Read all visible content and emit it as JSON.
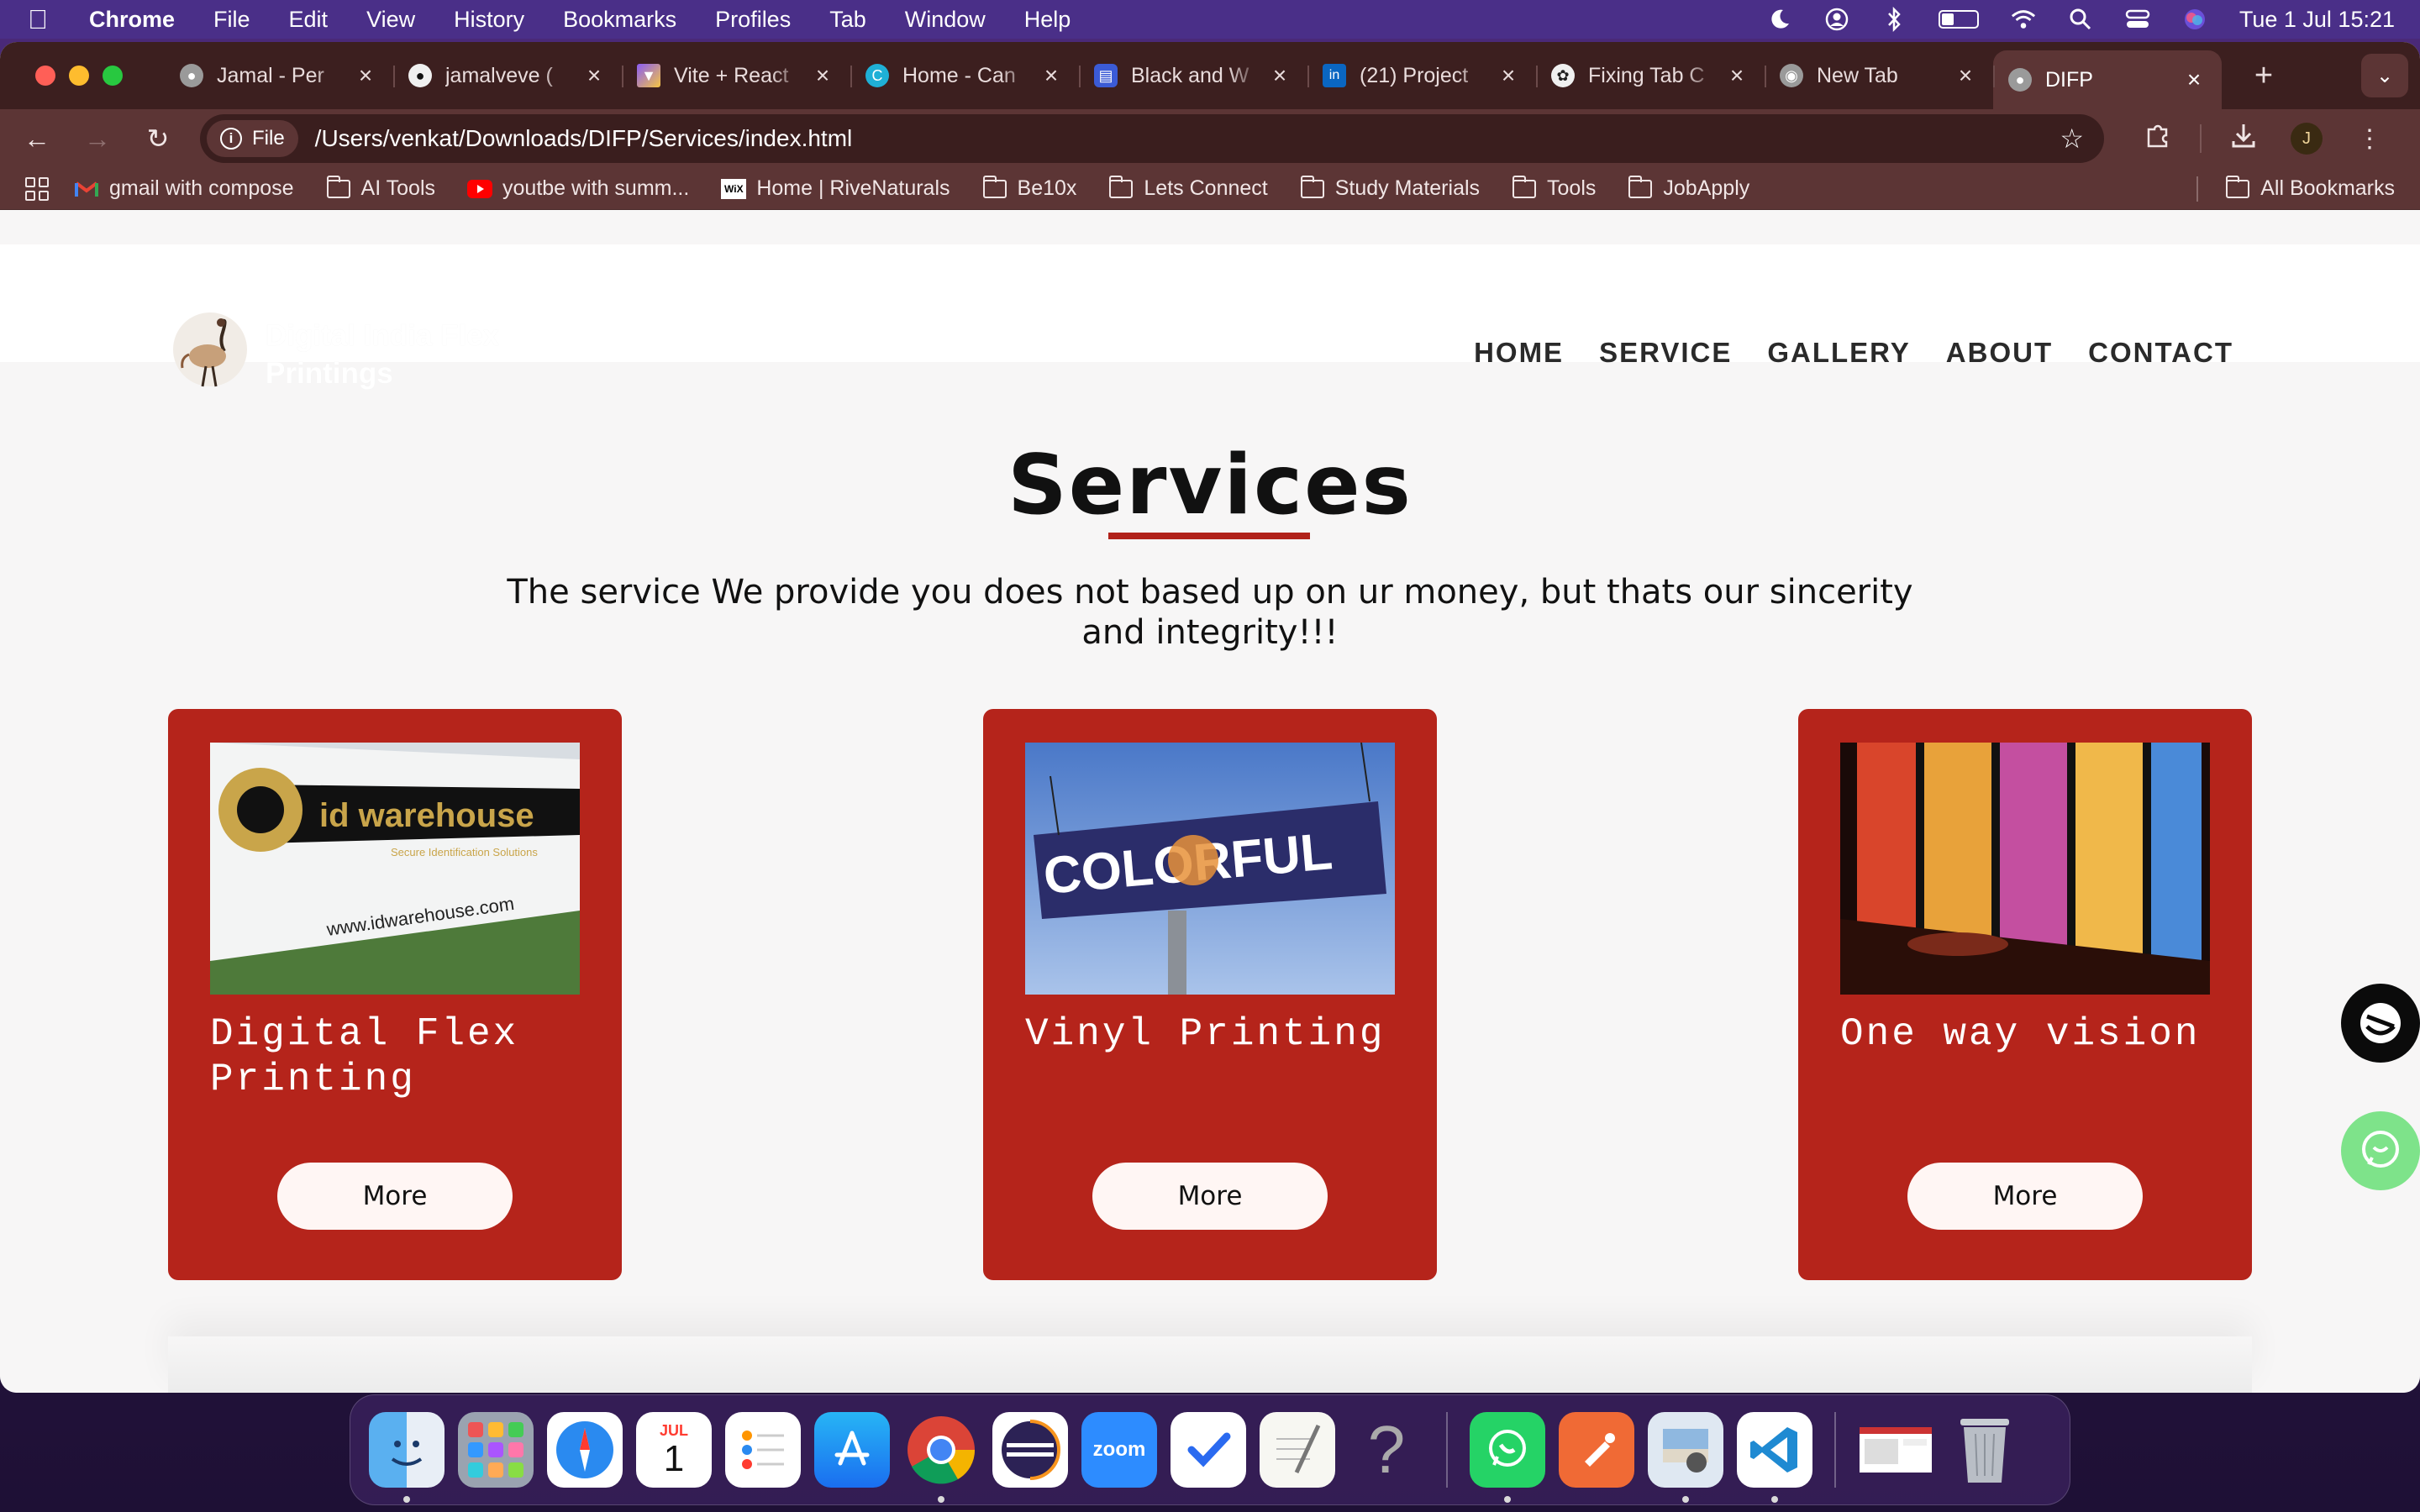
{
  "menubar": {
    "app_name": "Chrome",
    "items": [
      "File",
      "Edit",
      "View",
      "History",
      "Bookmarks",
      "Profiles",
      "Tab",
      "Window",
      "Help"
    ],
    "clock": "Tue 1 Jul  15:21"
  },
  "browser": {
    "tabs": [
      {
        "title": "Jamal - Per",
        "icon": "globe-icon",
        "color": "#9a9a9a"
      },
      {
        "title": "jamalveve (",
        "icon": "github-icon",
        "color": "#222222"
      },
      {
        "title": "Vite + React",
        "icon": "vite-icon",
        "color": "#8a5cf6"
      },
      {
        "title": "Home - Can",
        "icon": "canva-icon",
        "color": "#1fb0d6"
      },
      {
        "title": "Black and W",
        "icon": "printer-icon",
        "color": "#3b5bd6"
      },
      {
        "title": "(21) Project",
        "icon": "linkedin-icon",
        "color": "#0a66c2"
      },
      {
        "title": "Fixing Tab C",
        "icon": "openai-icon",
        "color": "#444444"
      },
      {
        "title": "New Tab",
        "icon": "chrome-icon",
        "color": "#9a9a9a"
      },
      {
        "title": "DIFP",
        "icon": "globe-icon",
        "color": "#9a9a9a"
      }
    ],
    "new_tab_label": "+",
    "file_chip": "File",
    "url": "/Users/venkat/Downloads/DIFP/Services/index.html",
    "profile_initial": "J",
    "bookmarks": [
      {
        "label": "gmail with compose",
        "icon": "gmail-icon"
      },
      {
        "label": "AI Tools",
        "icon": "folder-icon"
      },
      {
        "label": "youtbe with summ...",
        "icon": "youtube-icon"
      },
      {
        "label": "Home | RiveNaturals",
        "icon": "wix-icon"
      },
      {
        "label": "Be10x",
        "icon": "folder-icon"
      },
      {
        "label": "Lets Connect",
        "icon": "folder-icon"
      },
      {
        "label": "Study Materials",
        "icon": "folder-icon"
      },
      {
        "label": "Tools",
        "icon": "folder-icon"
      },
      {
        "label": "JobApply",
        "icon": "folder-icon"
      }
    ],
    "all_bookmarks": "All Bookmarks"
  },
  "site": {
    "logo_text": "Digital India Flex Printings",
    "nav": [
      "HOME",
      "SERVICE",
      "GALLERY",
      "ABOUT",
      "CONTACT"
    ],
    "title": "Services",
    "tagline": "The service We provide you does not based up on ur money, but thats our sincerity and integrity!!!",
    "cards": [
      {
        "title": "Digital Flex Printing",
        "button": "More",
        "image_text": "id warehouse",
        "image_sub": "Secure Identification Solutions",
        "image_url_text": "www.idwarehouse.com"
      },
      {
        "title": "Vinyl Printing",
        "button": "More",
        "image_text": "COLORFUL"
      },
      {
        "title": "One way vision",
        "button": "More"
      }
    ],
    "accent": "#b5241b"
  },
  "dock": {
    "apps": [
      "finder",
      "launchpad",
      "safari",
      "calendar",
      "reminders",
      "app-store",
      "chrome",
      "eclipse",
      "zoom",
      "tasks",
      "textedit",
      "help",
      "whatsapp",
      "postman",
      "preview",
      "vscode",
      "screenshot",
      "trash"
    ],
    "calendar_month": "JUL",
    "calendar_day": "1",
    "zoom_label": "zoom",
    "help_glyph": "?"
  }
}
